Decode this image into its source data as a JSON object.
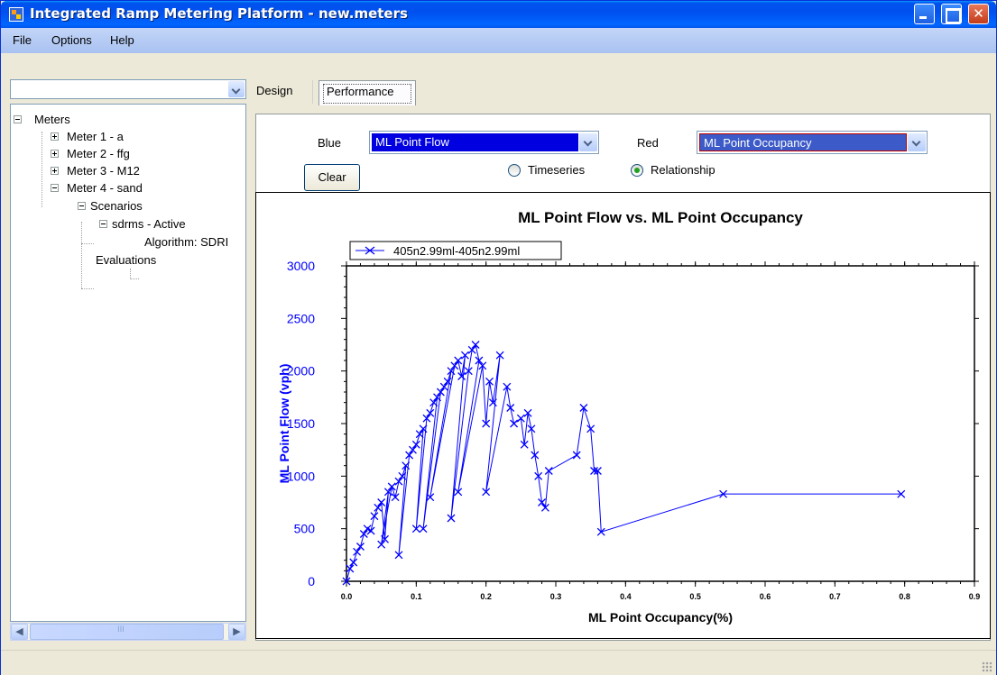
{
  "window": {
    "title": "Integrated Ramp Metering Platform - new.meters"
  },
  "menu": [
    "File",
    "Options",
    "Help"
  ],
  "left_combo": {
    "value": ""
  },
  "tree": {
    "root": "Meters",
    "meters": [
      "Meter 1 - a",
      "Meter 2 - ffg",
      "Meter 3 - M12",
      "Meter 4 - sand"
    ],
    "scenarios": "Scenarios",
    "scenario": "sdrms - Active",
    "algorithm": "Algorithm: SDRI",
    "evaluations": "Evaluations"
  },
  "scrollbar": {
    "grip": "III"
  },
  "tabs": {
    "design": "Design",
    "performance": "Performance"
  },
  "controls": {
    "blue_label": "Blue",
    "blue_value": "ML Point Flow",
    "red_label": "Red",
    "red_value": "ML Point Occupancy",
    "clear_button": "Clear",
    "timeseries_label": "Timeseries",
    "relationship_label": "Relationship",
    "selected_mode": "Relationship"
  },
  "colors": {
    "series": "#0000ff",
    "blue_select": "#0000e0",
    "red_select": "#3c5ac8",
    "red_border": "#c00000"
  },
  "chart_data": {
    "type": "scatter",
    "title": "ML Point Flow vs. ML Point Occupancy",
    "xlabel": "ML Point Occupancy(%)",
    "ylabel": "ML Point Flow (vph)",
    "xlim": [
      0,
      0.9
    ],
    "ylim": [
      0,
      3000
    ],
    "x_ticks": [
      "0.0",
      "0.1",
      "0.2",
      "0.3",
      "0.4",
      "0.5",
      "0.6",
      "0.7",
      "0.8",
      "0.9"
    ],
    "y_ticks": [
      "0",
      "500",
      "1000",
      "1500",
      "2000",
      "2500",
      "3000"
    ],
    "legend": "top-left",
    "series": [
      {
        "name": "405n2.99ml-405n2.99ml",
        "marker": "x",
        "connected": true,
        "x": [
          0.0,
          0.005,
          0.01,
          0.015,
          0.02,
          0.025,
          0.03,
          0.035,
          0.04,
          0.045,
          0.05,
          0.055,
          0.06,
          0.05,
          0.065,
          0.07,
          0.075,
          0.08,
          0.085,
          0.075,
          0.09,
          0.095,
          0.1,
          0.105,
          0.11,
          0.1,
          0.115,
          0.12,
          0.125,
          0.13,
          0.11,
          0.135,
          0.14,
          0.145,
          0.15,
          0.12,
          0.155,
          0.16,
          0.165,
          0.17,
          0.15,
          0.175,
          0.18,
          0.185,
          0.19,
          0.16,
          0.195,
          0.2,
          0.205,
          0.21,
          0.22,
          0.2,
          0.23,
          0.235,
          0.24,
          0.25,
          0.255,
          0.26,
          0.265,
          0.27,
          0.275,
          0.28,
          0.285,
          0.29,
          0.33,
          0.34,
          0.35,
          0.355,
          0.36,
          0.365,
          0.54,
          0.795
        ],
        "y": [
          0,
          120,
          180,
          280,
          330,
          450,
          500,
          480,
          620,
          700,
          750,
          400,
          850,
          350,
          900,
          800,
          950,
          1000,
          1100,
          250,
          1200,
          1250,
          1300,
          1400,
          1450,
          500,
          1550,
          1600,
          1700,
          1750,
          500,
          1800,
          1850,
          1900,
          2000,
          800,
          2050,
          2100,
          1950,
          2150,
          600,
          2000,
          2200,
          2250,
          2100,
          850,
          2050,
          1500,
          1900,
          1700,
          2150,
          850,
          1850,
          1650,
          1500,
          1550,
          1300,
          1600,
          1450,
          1200,
          1000,
          750,
          700,
          1050,
          1200,
          1650,
          1450,
          1050,
          1050,
          470,
          830,
          830
        ]
      }
    ]
  }
}
